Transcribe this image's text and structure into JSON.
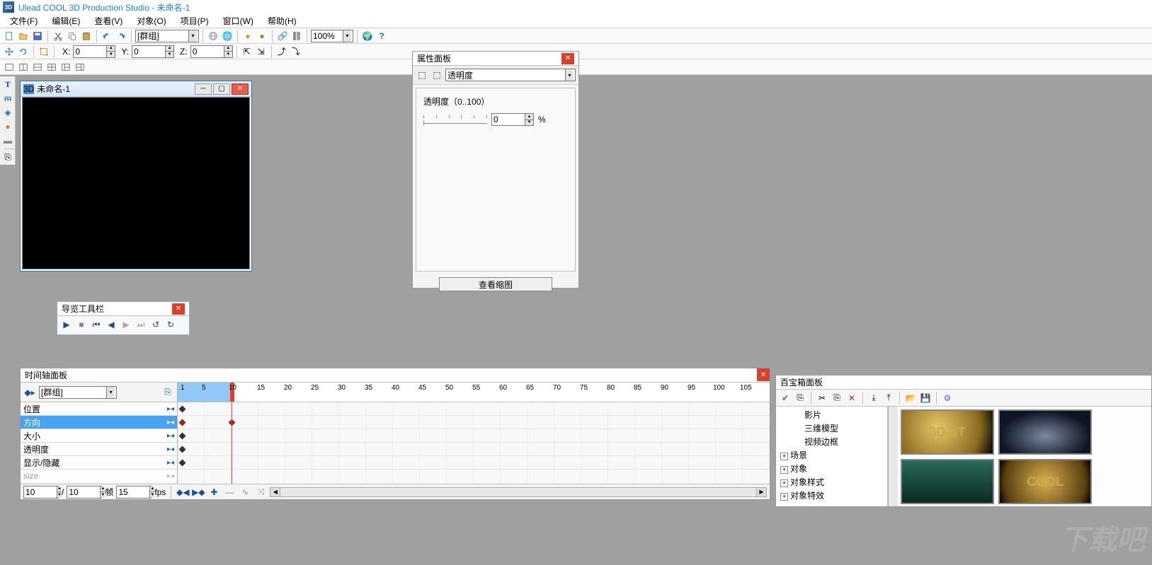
{
  "app": {
    "title": "Ulead COOL 3D Production Studio - 未命名-1",
    "icon_label": "3D"
  },
  "menu": {
    "file": "文件(F)",
    "edit": "编辑(E)",
    "view": "查看(V)",
    "object": "对象(O)",
    "project": "项目(P)",
    "window": "窗口(W)",
    "help": "帮助(H)"
  },
  "toolbar1": {
    "group_combo": "[群组]",
    "zoom_combo": "100%"
  },
  "toolbar2": {
    "x_label": "X:",
    "y_label": "Y:",
    "z_label": "Z:",
    "x": "0",
    "y": "0",
    "z": "0"
  },
  "doc": {
    "title": "未命名-1"
  },
  "attr_panel": {
    "title": "属性面板",
    "combo": "透明度",
    "slider_label": "透明度（0..100）",
    "value": "0",
    "percent": "%",
    "view_thumb": "查看缩图"
  },
  "nav_toolbar": {
    "title": "导览工具栏"
  },
  "timeline": {
    "title": "时间轴面板",
    "combo": "[群组]",
    "ruler_nums": [
      "1",
      "5",
      "10",
      "15",
      "20",
      "25",
      "30",
      "35",
      "40",
      "45",
      "50",
      "55",
      "60",
      "65",
      "70",
      "75",
      "80",
      "85",
      "90",
      "95",
      "100",
      "105"
    ],
    "props": {
      "pos": "位置",
      "dir": "方向",
      "scale": "大小",
      "opacity": "透明度",
      "showhide": "显示/隐藏",
      "size": "size"
    },
    "footer": {
      "frame_a": "10",
      "slash": "/",
      "frame_b": "10",
      "frame_unit": "帧",
      "fps_val": "15",
      "fps_unit": "fps"
    }
  },
  "treasure": {
    "title": "百宝箱面板",
    "tree": {
      "movie": "影片",
      "model3d": "三维模型",
      "video_border": "视频边框",
      "scene": "场景",
      "object": "对象",
      "obj_style": "对象样式",
      "obj_fx": "对象特效"
    },
    "thumbs": {
      "a": "3D ST",
      "b": "",
      "c": "",
      "d": "COOL"
    }
  },
  "watermark": "下载吧"
}
